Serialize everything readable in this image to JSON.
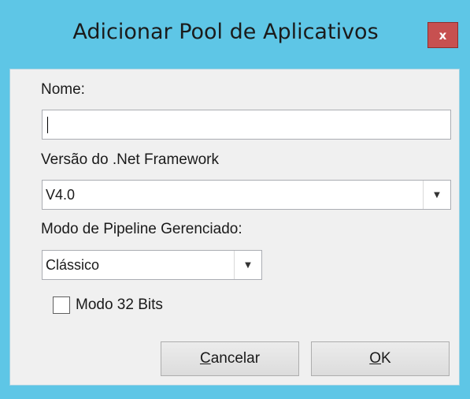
{
  "dialog": {
    "title": "Adicionar Pool de Aplicativos",
    "close_glyph": "x",
    "close_icon": "close-icon"
  },
  "form": {
    "name_label": "Nome:",
    "name_value": "",
    "framework_label": "Versão do .Net Framework",
    "framework_value": "V4.0",
    "pipeline_label": "Modo de Pipeline Gerenciado:",
    "pipeline_value": "Clássico",
    "mode32_label": "Modo 32 Bits",
    "mode32_checked": false,
    "dropdown_icon": "chevron-down-icon"
  },
  "buttons": {
    "cancel_label_access": "C",
    "cancel_label_rest": "ancelar",
    "ok_label_access": "O",
    "ok_label_rest": "K"
  },
  "colors": {
    "frame": "#5ec6e6",
    "client": "#f0f0f0",
    "close_button": "#c75050"
  }
}
